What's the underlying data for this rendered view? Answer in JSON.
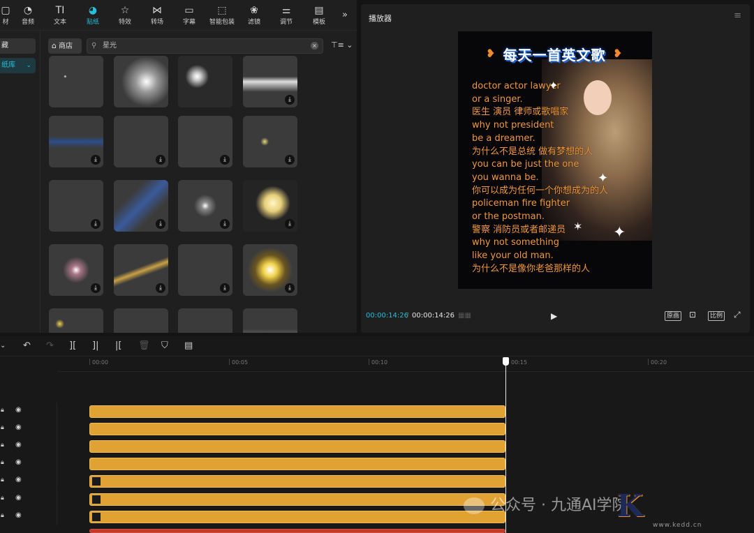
{
  "toolbar": {
    "tabs": [
      {
        "label": "材",
        "icon": "media-icon"
      },
      {
        "label": "音频",
        "icon": "audio-icon"
      },
      {
        "label": "文本",
        "icon": "text-icon"
      },
      {
        "label": "贴纸",
        "icon": "sticker-icon",
        "active": true
      },
      {
        "label": "特效",
        "icon": "effects-icon"
      },
      {
        "label": "转场",
        "icon": "transition-icon"
      },
      {
        "label": "字幕",
        "icon": "subtitle-icon"
      },
      {
        "label": "智能包装",
        "icon": "smart-pack-icon"
      },
      {
        "label": "滤镜",
        "icon": "filter-icon"
      },
      {
        "label": "调节",
        "icon": "adjust-icon"
      },
      {
        "label": "模板",
        "icon": "template-icon"
      }
    ],
    "more": "»"
  },
  "sidebar": {
    "items": [
      {
        "label": "藏"
      },
      {
        "label": "纸库",
        "active": true,
        "chevron": "⌄"
      }
    ]
  },
  "search": {
    "store_label": "商店",
    "value": "星光",
    "clear": "×",
    "filter": "⊤≡ ⌄"
  },
  "stickers": {
    "download_glyph": "⤓"
  },
  "player": {
    "title": "播放器",
    "menu": "≡",
    "song_title": "每天一首英文歌",
    "lyrics": [
      "doctor actor lawyer",
      "or a singer.",
      "医生 演员 律师或歌唱家",
      "why not president",
      "be a dreamer.",
      "为什么不是总统 做有梦想的人",
      "you can be just the one",
      "you wanna be.",
      "你可以成为任何一个你想成为的人",
      "policeman fire fighter",
      "or the postman.",
      "警察 消防员或者邮递员",
      "why not something",
      "like your old man.",
      "为什么不是像你老爸那样的人"
    ],
    "time_current": "00:00:14:26",
    "time_separator": "/",
    "time_total": "00:00:14:26",
    "controls": {
      "original": "原画",
      "ratio": "比例"
    }
  },
  "timeline": {
    "ruler_labels": [
      "00:00",
      "00:05",
      "00:10",
      "00:15",
      "00:20"
    ]
  },
  "watermark": {
    "text": "公众号 · 九通AI学院",
    "brand": "K",
    "site": "www.kedd.cn"
  },
  "colors": {
    "accent": "#25c0d8",
    "clip": "#e0a233",
    "lyric": "#f29a3a"
  }
}
